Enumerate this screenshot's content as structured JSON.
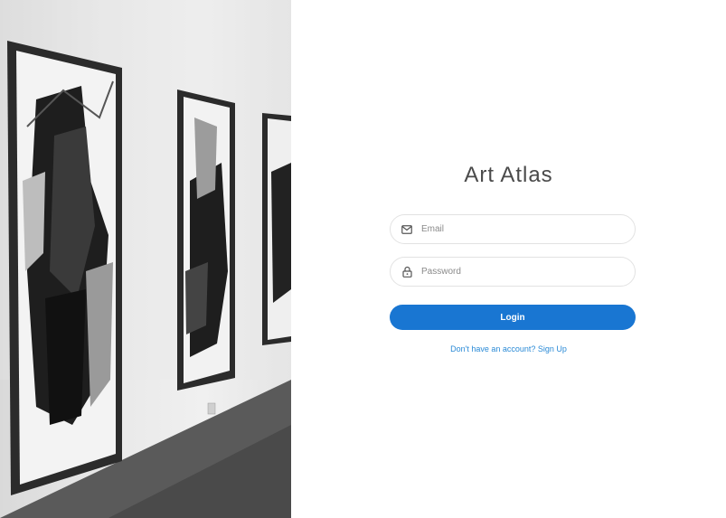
{
  "brand": {
    "title": "Art Atlas"
  },
  "form": {
    "email": {
      "placeholder": "Email",
      "value": ""
    },
    "password": {
      "placeholder": "Password",
      "value": ""
    },
    "login_label": "Login",
    "signup_text": "Don't have an account? Sign Up"
  },
  "colors": {
    "accent": "#1976d2",
    "link": "#2a8ad6"
  },
  "icons": {
    "email": "envelope-icon",
    "password": "lock-icon"
  }
}
